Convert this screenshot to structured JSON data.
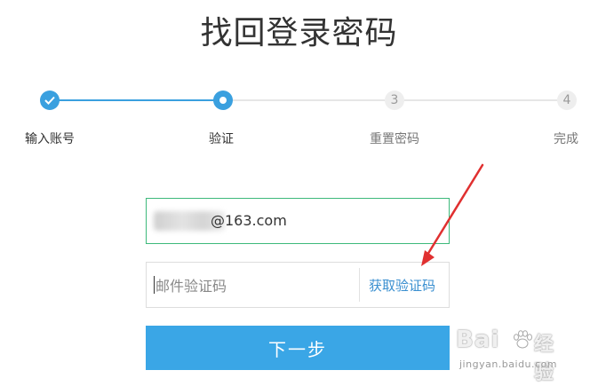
{
  "page": {
    "title": "找回登录密码"
  },
  "steps": [
    {
      "label": "输入账号",
      "state": "done"
    },
    {
      "label": "验证",
      "state": "current"
    },
    {
      "label": "重置密码",
      "state": "todo",
      "number": "3"
    },
    {
      "label": "完成",
      "state": "todo",
      "number": "4"
    }
  ],
  "form": {
    "email_value": "@163.com",
    "code_placeholder": "邮件验证码",
    "get_code_label": "获取验证码",
    "next_label": "下一步"
  },
  "colors": {
    "accent": "#3aa0df",
    "button": "#3aa6e6",
    "focus_border": "#3db97b",
    "arrow": "#e03030"
  },
  "watermark": {
    "brand_logo": "Bai",
    "brand_text": "经验",
    "url": "jingyan.baidu.com"
  }
}
